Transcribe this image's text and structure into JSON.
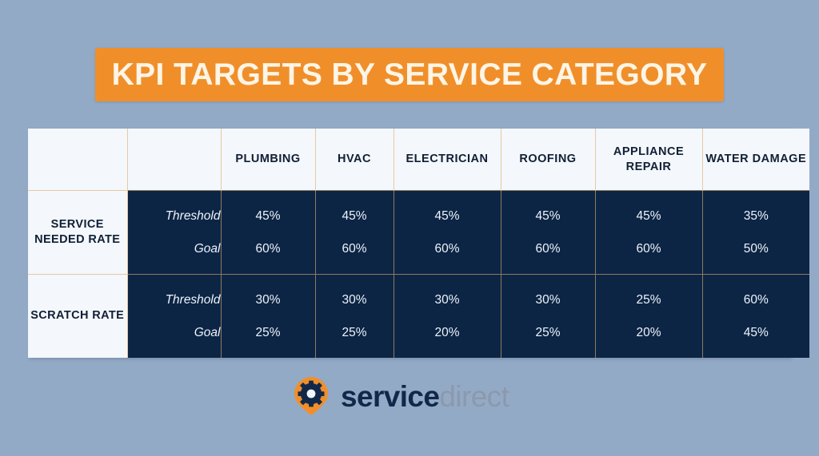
{
  "header": {
    "title": "KPI TARGETS BY SERVICE CATEGORY",
    "banner_color": "#f08f2a",
    "title_color": "#fdf5e6"
  },
  "page": {
    "background_color": "#93aac7"
  },
  "table": {
    "corner_label_1": "",
    "corner_label_2": "",
    "categories": [
      "PLUMBING",
      "HVAC",
      "ELECTRICIAN",
      "ROOFING",
      "APPLIANCE REPAIR",
      "WATER DAMAGE"
    ],
    "metric_labels": {
      "threshold": "Threshold",
      "goal": "Goal"
    },
    "rows": [
      {
        "label": "SERVICE NEEDED RATE",
        "threshold": [
          "45%",
          "45%",
          "45%",
          "45%",
          "45%",
          "35%"
        ],
        "goal": [
          "60%",
          "60%",
          "60%",
          "60%",
          "60%",
          "50%"
        ]
      },
      {
        "label": "SCRATCH RATE",
        "threshold": [
          "30%",
          "30%",
          "30%",
          "30%",
          "25%",
          "60%"
        ],
        "goal": [
          "25%",
          "25%",
          "20%",
          "25%",
          "20%",
          "45%"
        ]
      }
    ],
    "cell_dark_color": "#0c2545",
    "cell_light_color": "#f4f7fb",
    "divider_color": "#e7c9a3"
  },
  "logo": {
    "name_bold": "service",
    "name_light": "direct",
    "mark_color": "#f08f2a",
    "gear_color": "#12284a"
  }
}
